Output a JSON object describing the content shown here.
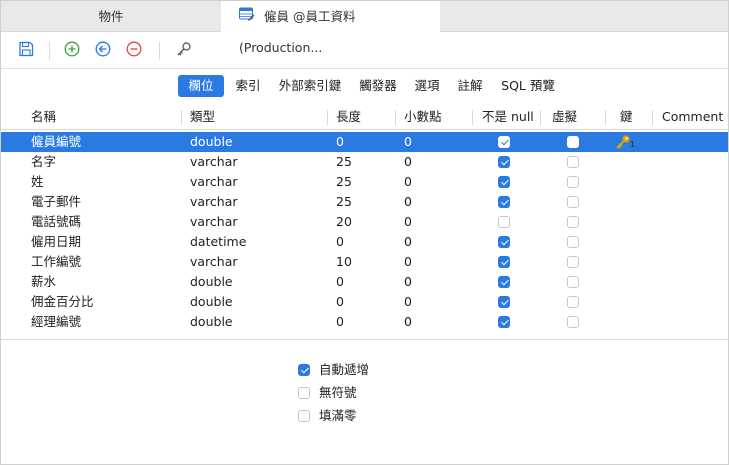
{
  "window_tabs": [
    {
      "label": "物件"
    },
    {
      "label": "僱員 @員工資料 (Production..."
    }
  ],
  "subtabs": [
    "欄位",
    "索引",
    "外部索引鍵",
    "觸發器",
    "選項",
    "註解",
    "SQL 預覽"
  ],
  "columns": [
    "名稱",
    "類型",
    "長度",
    "小數點",
    "不是 null",
    "虛擬",
    "鍵",
    "Comment"
  ],
  "rows": [
    {
      "name": "僱員編號",
      "type": "double",
      "length": "0",
      "decimals": "0",
      "not_null": true,
      "virtual": false,
      "key": "1"
    },
    {
      "name": "名字",
      "type": "varchar",
      "length": "25",
      "decimals": "0",
      "not_null": true,
      "virtual": false,
      "key": ""
    },
    {
      "name": "姓",
      "type": "varchar",
      "length": "25",
      "decimals": "0",
      "not_null": true,
      "virtual": false,
      "key": ""
    },
    {
      "name": "電子郵件",
      "type": "varchar",
      "length": "25",
      "decimals": "0",
      "not_null": true,
      "virtual": false,
      "key": ""
    },
    {
      "name": "電話號碼",
      "type": "varchar",
      "length": "20",
      "decimals": "0",
      "not_null": false,
      "virtual": false,
      "key": ""
    },
    {
      "name": "僱用日期",
      "type": "datetime",
      "length": "0",
      "decimals": "0",
      "not_null": true,
      "virtual": false,
      "key": ""
    },
    {
      "name": "工作編號",
      "type": "varchar",
      "length": "10",
      "decimals": "0",
      "not_null": true,
      "virtual": false,
      "key": ""
    },
    {
      "name": "薪水",
      "type": "double",
      "length": "0",
      "decimals": "0",
      "not_null": true,
      "virtual": false,
      "key": ""
    },
    {
      "name": "佣金百分比",
      "type": "double",
      "length": "0",
      "decimals": "0",
      "not_null": true,
      "virtual": false,
      "key": ""
    },
    {
      "name": "經理編號",
      "type": "double",
      "length": "0",
      "decimals": "0",
      "not_null": true,
      "virtual": false,
      "key": ""
    }
  ],
  "options": [
    {
      "label": "自動遞增",
      "checked": true
    },
    {
      "label": "無符號",
      "checked": false
    },
    {
      "label": "填滿零",
      "checked": false
    }
  ],
  "colors": {
    "accent": "#2a7ae2",
    "add_green": "#3aa63a",
    "nav_blue": "#2a7ae2",
    "remove_red": "#e0453a",
    "key_gold": "#e0a400"
  },
  "icons": {
    "save": "save-icon",
    "add": "plus-circle-icon",
    "insert": "arrow-left-circle-icon",
    "remove": "minus-circle-icon",
    "key": "key-icon"
  }
}
